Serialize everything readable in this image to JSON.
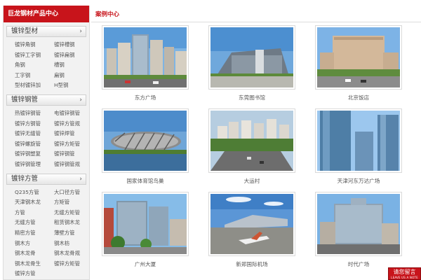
{
  "sidebar": {
    "title": "巨龙钢材产品中心",
    "categories": [
      {
        "name": "镀锌型材",
        "items": [
          "镀锌角钢",
          "镀锌槽钢",
          "镀锌工字钢",
          "镀锌扁钢",
          "角钢",
          "槽钢",
          "工字钢",
          "扁钢",
          "型材镀锌加",
          "H型钢"
        ]
      },
      {
        "name": "镀锌钢管",
        "items": [
          "热镀锌钢管",
          "电镀锌钢管",
          "镀锌方钢管",
          "镀锌方管规",
          "镀锌无缝管",
          "镀锌焊管",
          "镀锌螺旋管",
          "镀锌方矩管",
          "镀锌钢塑复",
          "镀锌钢管",
          "镀锌钢管理",
          "镀锌钢管规"
        ]
      },
      {
        "name": "镀锌方管",
        "items": [
          "Q235方管",
          "大口径方管",
          "天津钢木龙",
          "方矩管",
          "方管",
          "无缝方矩管",
          "无缝方管",
          "租赁钢木龙",
          "精密方管",
          "薄壁方管",
          "钢木方",
          "钢木枋",
          "钢木龙骨",
          "钢木龙骨规",
          "钢木龙骨生",
          "镀锌方矩管",
          "镀锌方管"
        ]
      }
    ]
  },
  "main": {
    "title": "案例中心",
    "cases": [
      {
        "caption": "东方广场",
        "photo": "office-building-photo"
      },
      {
        "caption": "东莞图书馆",
        "photo": "library-photo"
      },
      {
        "caption": "北京饭店",
        "photo": "hotel-photo"
      },
      {
        "caption": "国家体育馆鸟巢",
        "photo": "stadium-photo"
      },
      {
        "caption": "大运村",
        "photo": "residential-towers-photo"
      },
      {
        "caption": "天津河东万达广场",
        "photo": "glass-towers-photo"
      },
      {
        "caption": "广州大厦",
        "photo": "guangzhou-tower-photo"
      },
      {
        "caption": "新郑国际机场",
        "photo": "airport-photo"
      },
      {
        "caption": "时代广场",
        "photo": "times-square-photo"
      }
    ]
  },
  "message_button": {
    "label": "请您留言",
    "sublabel": "LEAVE US A NOTE"
  }
}
